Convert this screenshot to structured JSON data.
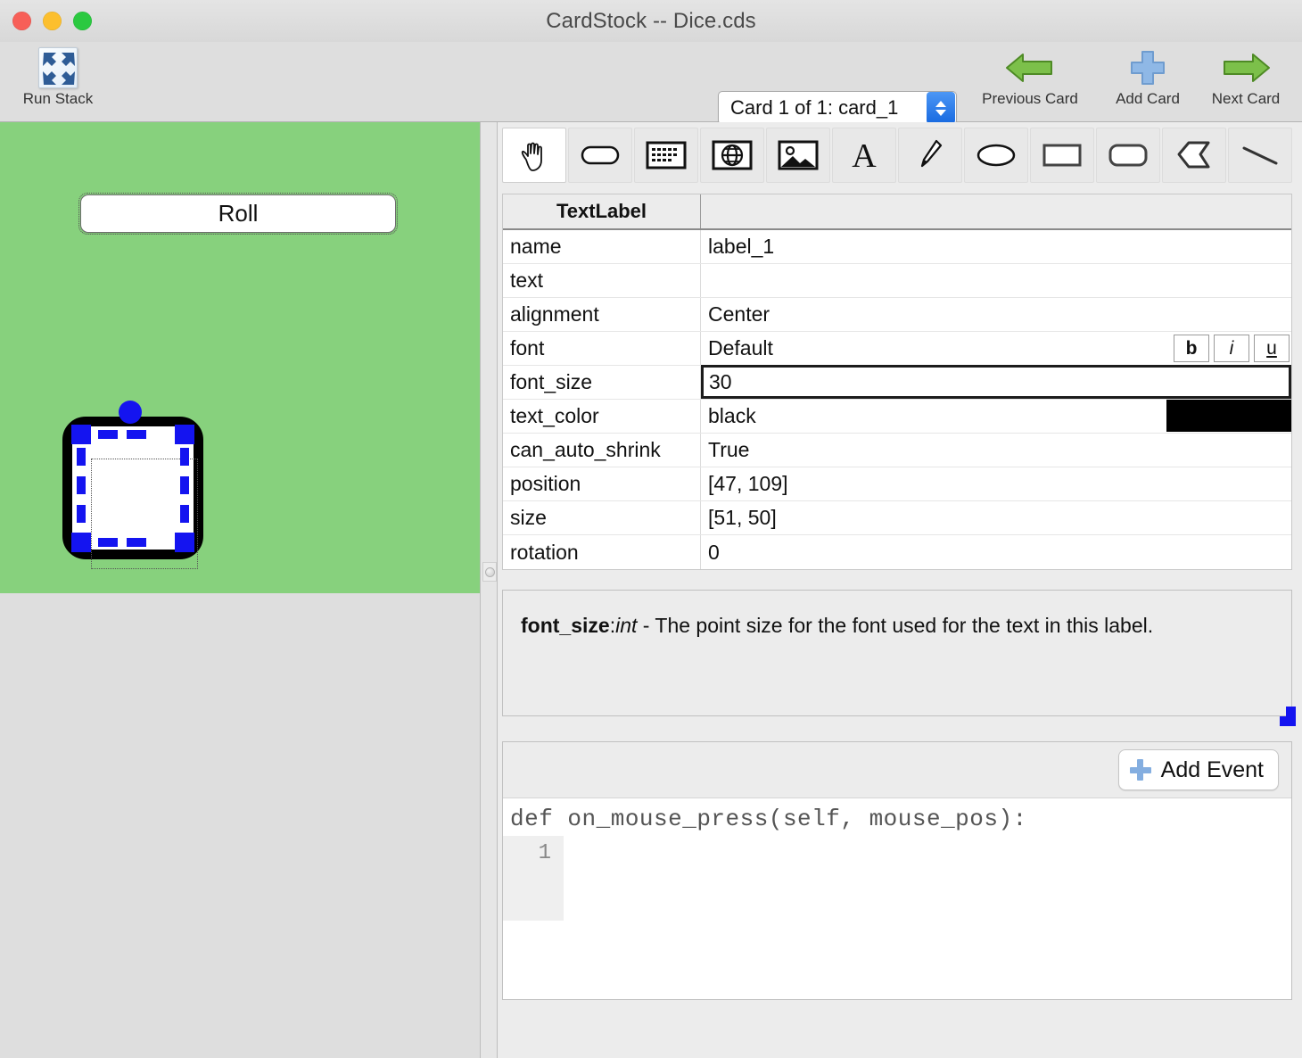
{
  "window": {
    "title": "CardStock -- Dice.cds",
    "traffic_lights": [
      "close-button",
      "minimize-button",
      "zoom-button"
    ]
  },
  "toolbar": {
    "run_stack": {
      "label": "Run Stack",
      "icon": "run-stack-icon"
    },
    "card_select": {
      "value": "Card 1 of 1: card_1"
    },
    "previous_card": {
      "label": "Previous Card",
      "icon": "left-arrow-icon"
    },
    "add_card": {
      "label": "Add Card",
      "icon": "plus-icon"
    },
    "next_card": {
      "label": "Next Card",
      "icon": "right-arrow-icon"
    }
  },
  "card": {
    "background_color": "#87d17d",
    "roll_button": {
      "label": "Roll"
    },
    "selected_object": {
      "type": "rounded-rect",
      "handle_color": "#1414f0"
    }
  },
  "palette": {
    "tools": [
      {
        "name": "hand-tool",
        "selected": true
      },
      {
        "name": "button-tool",
        "selected": false
      },
      {
        "name": "textfield-tool",
        "selected": false
      },
      {
        "name": "webview-tool",
        "selected": false
      },
      {
        "name": "image-tool",
        "selected": false
      },
      {
        "name": "textlabel-tool",
        "selected": false
      },
      {
        "name": "pen-tool",
        "selected": false
      },
      {
        "name": "oval-tool",
        "selected": false
      },
      {
        "name": "rect-tool",
        "selected": false
      },
      {
        "name": "roundrect-tool",
        "selected": false
      },
      {
        "name": "polygon-tool",
        "selected": false
      },
      {
        "name": "line-tool",
        "selected": false
      }
    ]
  },
  "inspector": {
    "header": {
      "type": "TextLabel",
      "value_col": ""
    },
    "rows": [
      {
        "name": "name",
        "value": "label_1"
      },
      {
        "name": "text",
        "value": ""
      },
      {
        "name": "alignment",
        "value": "Center"
      },
      {
        "name": "font",
        "value": "Default"
      },
      {
        "name": "font_size",
        "value": "30"
      },
      {
        "name": "text_color",
        "value": "black"
      },
      {
        "name": "can_auto_shrink",
        "value": "True"
      },
      {
        "name": "position",
        "value": "[47, 109]"
      },
      {
        "name": "size",
        "value": "[51, 50]"
      },
      {
        "name": "rotation",
        "value": "0"
      }
    ],
    "font_style_buttons": {
      "bold": "b",
      "italic": "i",
      "underline": "u"
    },
    "text_color_swatch": "#000000",
    "focused_field": "font_size"
  },
  "help": {
    "prop_name": "font_size",
    "prop_type": "int",
    "separator": " - ",
    "description": "The point size for the font used for the text in this label."
  },
  "code": {
    "add_event_label": "Add Event",
    "signature": "def on_mouse_press(self, mouse_pos):",
    "line_numbers": [
      "1"
    ],
    "lines": [
      ""
    ]
  }
}
